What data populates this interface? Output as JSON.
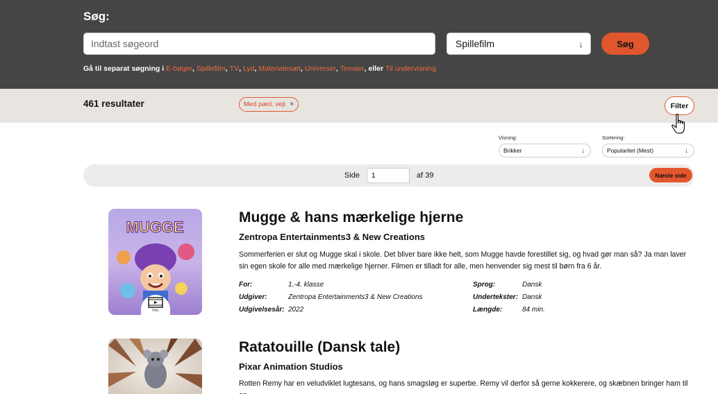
{
  "search": {
    "label": "Søg:",
    "placeholder": "Indtast søgeord",
    "value": "",
    "category": "Spillefilm",
    "button_label": "Søg",
    "separate_prefix": "Gå til separat søgning i",
    "separate_links": [
      "E-bøger",
      "Spillefilm",
      "TV",
      "Lyd",
      "Materialesæt",
      "Universer",
      "Temaer"
    ],
    "separate_or": ", eller",
    "teaching_link": "Til undervisning"
  },
  "results_bar": {
    "count": "461 resultater",
    "active_filter": "Med pæd. vejl.",
    "remove_symbol": "×",
    "filter_label": "Filter"
  },
  "controls": {
    "view_label": "Visning:",
    "view_value": "Brikker",
    "sort_label": "Sortering:",
    "sort_value": "Popularitet (Mest)"
  },
  "pagination": {
    "side_label": "Side",
    "page": "1",
    "of_label": "af 39",
    "next_label": "Næste side"
  },
  "results": [
    {
      "title": "Mugge & hans mærkelige hjerne",
      "publisher": "Zentropa Entertainments3 & New Creations",
      "description": "Sommerferien er slut og Mugge skal i skole. Det bliver bare ikke helt, som Mugge havde forestillet sig, og hvad gør man så? Ja man laver sin egen skole for alle med mærkelige hjerner. Filmen er tilladt for alle, men henvender sig mest til børn fra 6 år.",
      "media_label": "Film",
      "poster_text": "MUGGE",
      "meta": {
        "for_label": "For:",
        "for_value": "1.-4. klasse",
        "publisher_label": "Udgiver:",
        "publisher_value": "Zentropa Entertainments3 & New Creations",
        "year_label": "Udgivelsesår:",
        "year_value": "2022",
        "language_label": "Sprog:",
        "language_value": "Dansk",
        "subtitles_label": "Undertekster:",
        "subtitles_value": "Dansk",
        "length_label": "Længde:",
        "length_value": "84 min."
      }
    },
    {
      "title": "Ratatouille (Dansk tale)",
      "publisher": "Pixar Animation Studios",
      "description": "Rotten Remy har en veludviklet lugtesans, og hans smagsløg er superbe. Remy vil derfor så gerne kokkerere, og skæbnen bringer ham til en"
    }
  ],
  "colors": {
    "header_bg": "#454545",
    "accent": "#e2562d",
    "results_bar_bg": "#e8e5e1",
    "pagination_bg": "#eeeceb"
  },
  "icons": {
    "category_arrow": "↓",
    "view_arrow": "↓",
    "sort_arrow": "↓",
    "media_icon": "film-icon",
    "cursor": "hand-pointer-icon"
  }
}
